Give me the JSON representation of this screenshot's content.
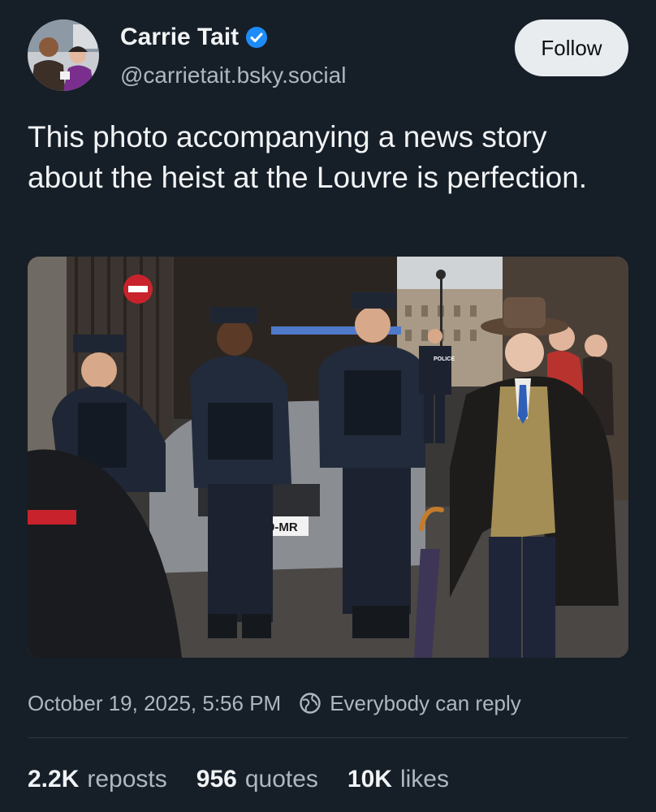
{
  "post": {
    "author": {
      "display_name": "Carrie Tait",
      "handle": "@carrietait.bsky.social",
      "verified": true,
      "avatar_icon": "avatar-photo"
    },
    "follow_label": "Follow",
    "text": "This photo accompanying a news story about the heist at the Louvre is perfection.",
    "image": {
      "content": "police-officers-and-man-in-fedora-photo",
      "sign_text": "POLICE",
      "plate_text": "9-MR"
    },
    "timestamp": "October 19, 2025, 5:56 PM",
    "reply_setting": "Everybody can reply",
    "stats": {
      "reposts_count": "2.2K",
      "reposts_label": "reposts",
      "quotes_count": "956",
      "quotes_label": "quotes",
      "likes_count": "10K",
      "likes_label": "likes"
    }
  },
  "colors": {
    "background": "#161e27",
    "text_primary": "#f1f3f5",
    "text_secondary": "#aeb7c1",
    "verified": "#1d8cf8",
    "follow_bg": "#e9ecef"
  }
}
